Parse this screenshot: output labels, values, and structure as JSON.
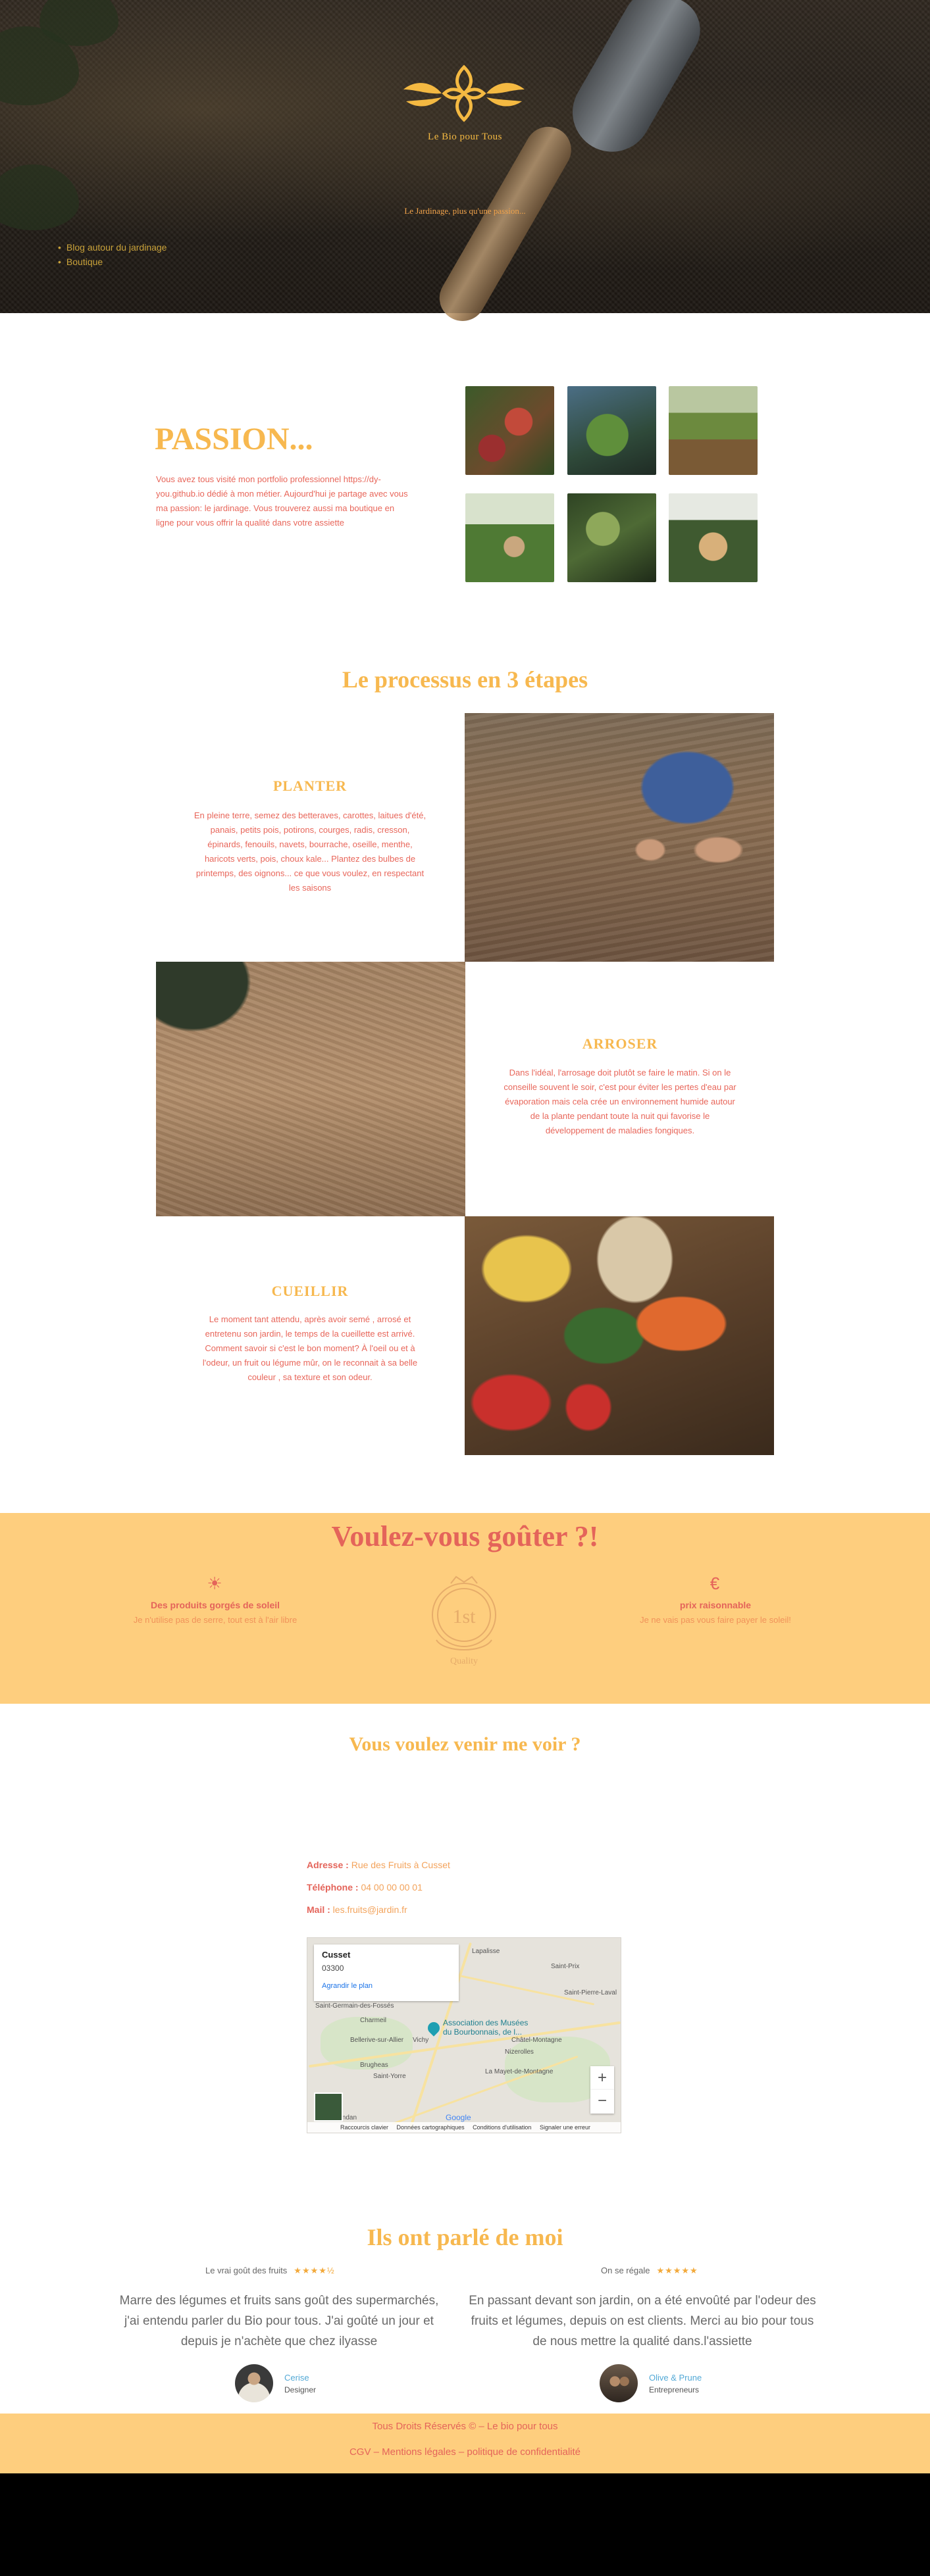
{
  "hero": {
    "brand": "Le Bio pour Tous",
    "tagline": "Le Jardinage, plus qu'une passion...",
    "nav": [
      "Blog autour du jardinage",
      "Boutique"
    ]
  },
  "passion": {
    "title": "PASSION...",
    "text": "Vous avez tous visité mon portfolio professionnel https://dy-you.github.io dédié à mon métier. Aujourd'hui je partage avec vous ma passion: le jardinage. Vous trouverez aussi ma boutique en ligne pour vous offrir la qualité dans votre assiette"
  },
  "process": {
    "title": "Le processus en 3 étapes",
    "steps": [
      {
        "head": "PLANTER",
        "text": "En pleine terre, semez des betteraves, carottes, laitues d'été, panais, petits pois, potirons, courges, radis, cresson, épinards, fenouils, navets, bourrache, oseille, menthe, haricots verts, pois, choux kale... Plantez des bulbes de printemps, des oignons... ce que vous voulez, en respectant les saisons"
      },
      {
        "head": "ARROSER",
        "text": "Dans l'idéal, l'arrosage doit plutôt se faire le matin. Si on le conseille souvent le soir, c'est pour éviter les pertes d'eau par évaporation mais cela crée un environnement humide autour de la plante pendant toute la nuit qui favorise le développement de maladies fongiques."
      },
      {
        "head": "CUEILLIR",
        "text": "Le moment tant attendu, après avoir semé , arrosé et entretenu son jardin, le temps de la cueillette est arrivé. Comment savoir si c'est le bon moment? À l'oeil ou et à l'odeur, un fruit ou légume mûr, on le reconnait à sa belle couleur , sa texture et son odeur."
      }
    ]
  },
  "taste": {
    "title": "Voulez-vous goûter ?!",
    "left": {
      "icon": "sun-icon",
      "glyph": "☀",
      "title": "Des produits gorgés de soleil",
      "text": "Je n'utilise pas de serre, tout est à l'air libre"
    },
    "badge": {
      "rank": "1st",
      "word": "Quality"
    },
    "right": {
      "icon": "euro-icon",
      "glyph": "€",
      "title": "prix raisonnable",
      "text": "Je ne vais pas vous faire payer le soleil!"
    }
  },
  "contact": {
    "title": "Vous voulez venir me voir ?",
    "address_label": "Adresse :",
    "address": "Rue des Fruits à Cusset",
    "phone_label": "Téléphone :",
    "phone": "04 00 00 00 01",
    "mail_label": "Mail :",
    "mail": "les.fruits@jardin.fr",
    "map": {
      "place": "Cusset",
      "postcode": "03300",
      "link": "Agrandir le plan",
      "marker_label": "Association des Musées du Bourbonnais, de l...",
      "towns": [
        "Vichy",
        "Saint-Pierre-Laval",
        "Charmeil",
        "Bellerive-sur-Allier",
        "Châtel-Montagne",
        "Nizerolles",
        "Brugheas",
        "Saint-Yorre",
        "La Mayet-de-Montagne",
        "Randan",
        "Lapalisse",
        "Saint-Prix",
        "Saint-Germain-des-Fossés"
      ],
      "zoom_in": "+",
      "zoom_out": "−",
      "google": "Google",
      "footer": [
        "Raccourcis clavier",
        "Données cartographiques",
        "Conditions d'utilisation",
        "Signaler une erreur cartographique"
      ]
    }
  },
  "testimonials": {
    "title": "Ils ont parlé de moi",
    "items": [
      {
        "head": "Le vrai goût des fruits",
        "stars": "★★★★½",
        "text": "Marre des légumes et fruits sans goût des supermarchés, j'ai entendu parler du Bio pour tous. J'ai goûté un jour et depuis je n'achète que chez ilyasse",
        "name": "Cerise",
        "role": "Designer"
      },
      {
        "head": "On se régale",
        "stars": "★★★★★",
        "text": "En passant devant son jardin, on a été envoûté par l'odeur des fruits et légumes, depuis on est clients. Merci au bio pour tous de nous mettre la qualité dans.l'assiette",
        "name": "Olive & Prune",
        "role": "Entrepreneurs"
      }
    ]
  },
  "footer": {
    "line1": "Tous Droits Réservés © – Le bio pour tous",
    "line2": "CGV – Mentions légales – politique de confidentialité"
  },
  "colors": {
    "accent": "#f7b84f",
    "coral": "#e4645a",
    "band": "#fece7e"
  }
}
